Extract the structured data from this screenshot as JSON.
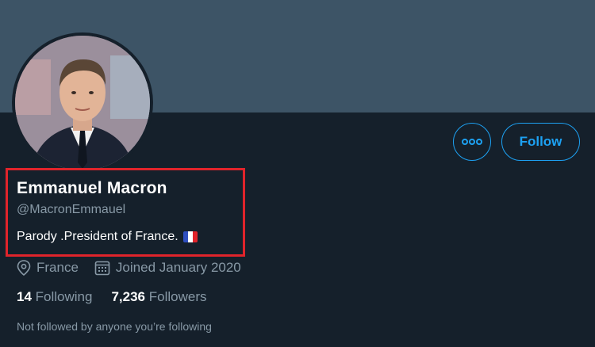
{
  "profile": {
    "name": "Emmanuel Macron",
    "handle": "@MacronEmmauel",
    "bio": "Parody .President of France.",
    "location": "France",
    "joined": "Joined January 2020"
  },
  "stats": {
    "following_count": "14",
    "following_label": "Following",
    "followers_count": "7,236",
    "followers_label": "Followers"
  },
  "actions": {
    "follow_label": "Follow",
    "more_icon": "ellipsis-icon"
  },
  "note": "Not followed by anyone you’re following",
  "colors": {
    "background": "#15202b",
    "banner": "#3d5466",
    "accent": "#1da1f2",
    "muted": "#8899a6",
    "highlight": "#e0242b"
  }
}
